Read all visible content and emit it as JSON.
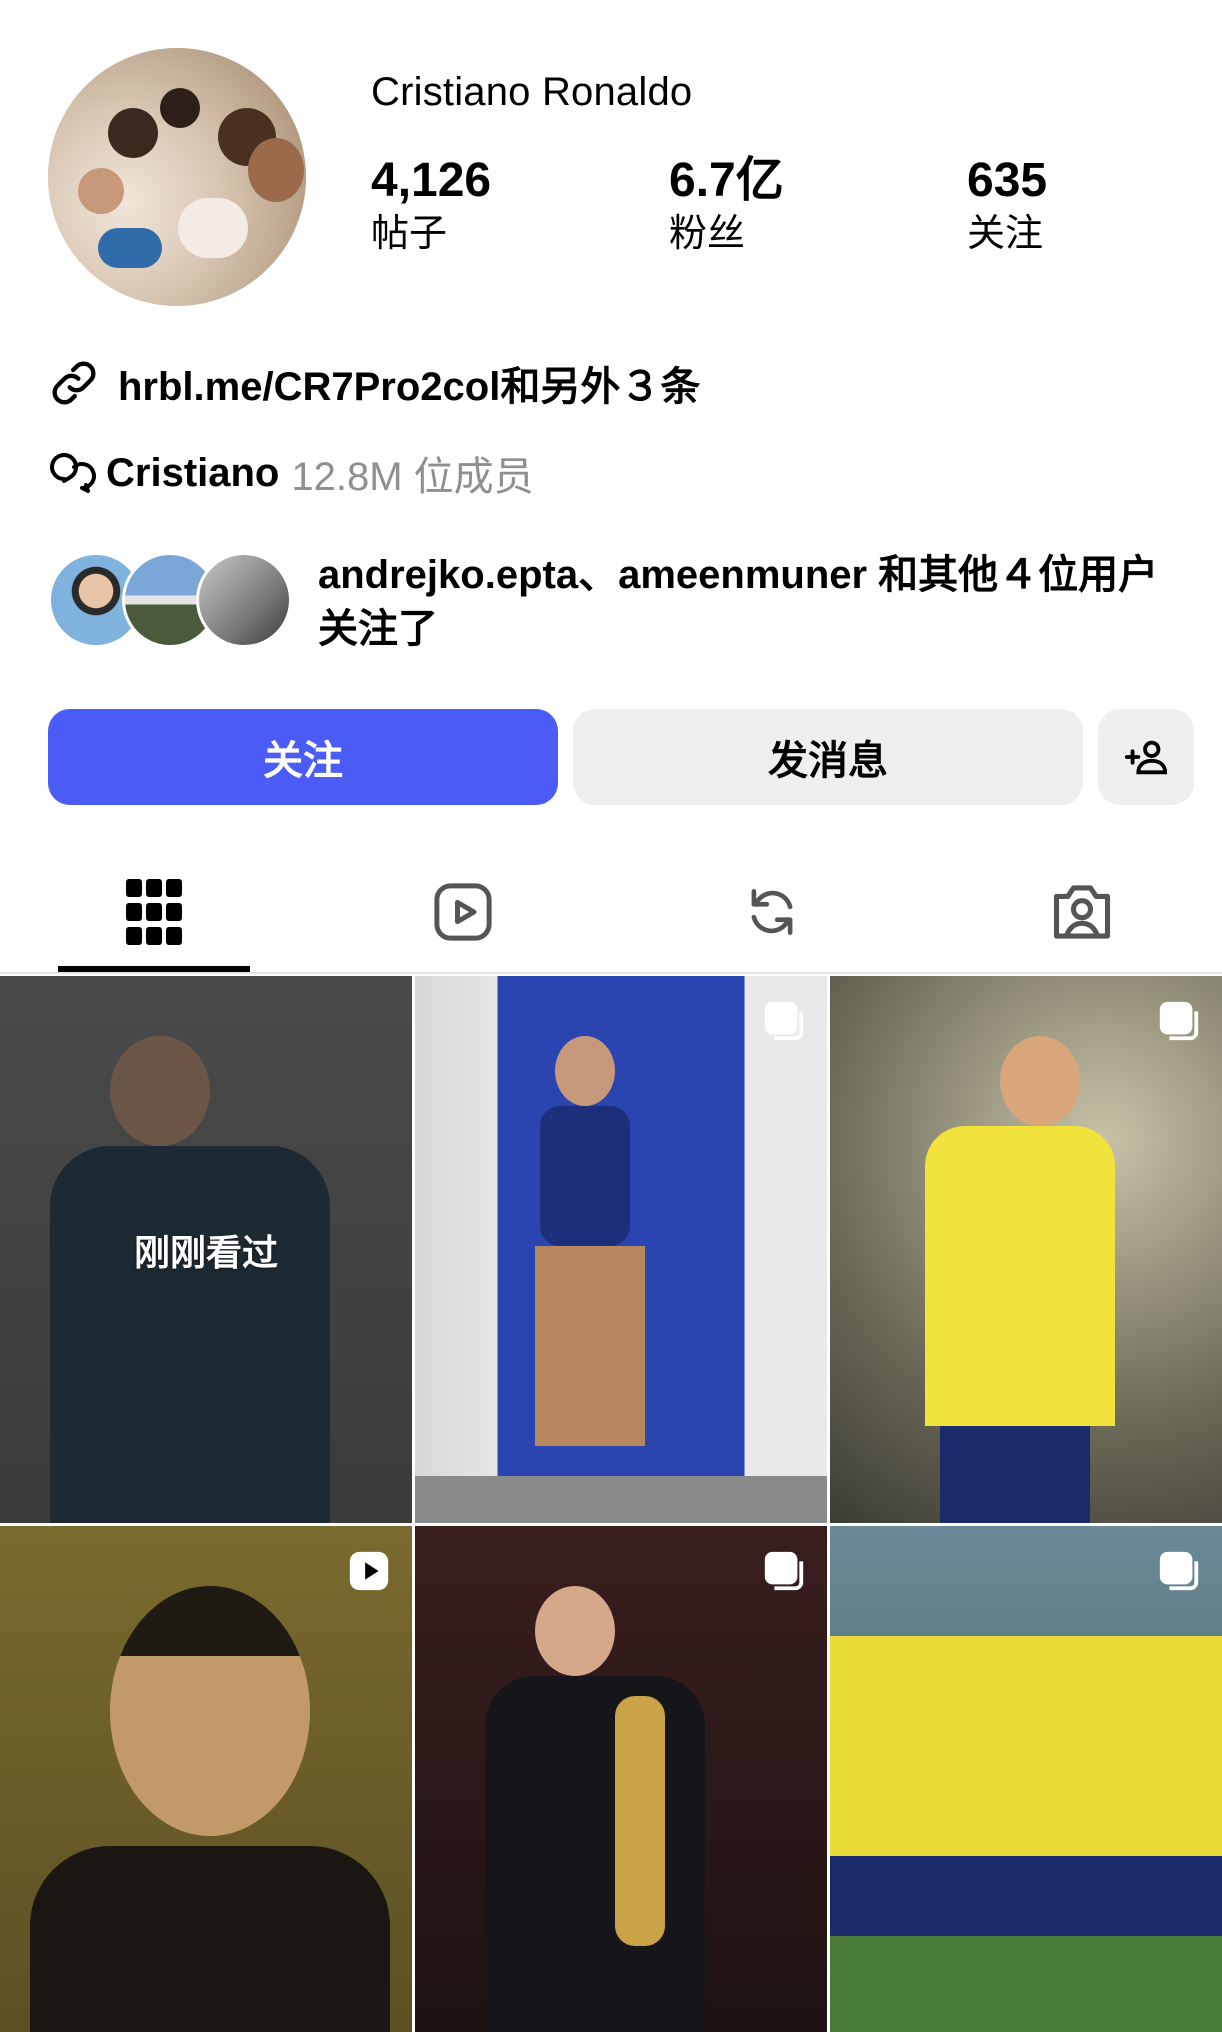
{
  "profile": {
    "name": "Cristiano Ronaldo",
    "stats": [
      {
        "value": "4,126",
        "label": "帖子"
      },
      {
        "value": "6.7亿",
        "label": "粉丝"
      },
      {
        "value": "635",
        "label": "关注"
      }
    ],
    "link_text": "hrbl.me/CR7Pro2col和另外３条",
    "channel": {
      "name": "Cristiano",
      "members": "12.8M 位成员"
    },
    "mutual_text": "andrejko.epta、ameenmuner 和其他４位用户关注了"
  },
  "actions": {
    "follow_label": "关注",
    "message_label": "发消息"
  },
  "tabs": [
    "grid-icon",
    "reels-icon",
    "reposts-icon",
    "tagged-icon"
  ],
  "grid": {
    "recently_viewed_label": "刚刚看过"
  },
  "colors": {
    "accent": "#4b5cf6",
    "button_bg": "#efeff2",
    "muted": "#8e8e93"
  }
}
